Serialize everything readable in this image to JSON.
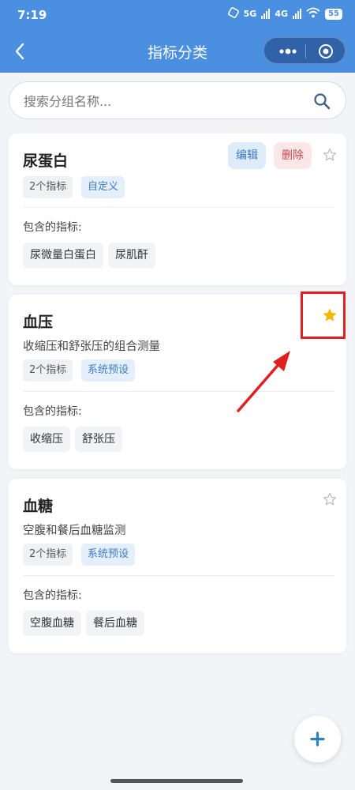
{
  "status": {
    "time": "7:19",
    "net1": "5G",
    "net2": "4G",
    "battery": "55"
  },
  "nav": {
    "title": "指标分类"
  },
  "search": {
    "placeholder": "搜索分组名称..."
  },
  "groups": [
    {
      "title": "尿蛋白",
      "description": "",
      "count": "2个指标",
      "type": "自定义",
      "edit_label": "编辑",
      "delete_label": "删除",
      "favorite": false,
      "includes_label": "包含的指标:",
      "indicators": [
        "尿微量白蛋白",
        "尿肌酐"
      ]
    },
    {
      "title": "血压",
      "description": "收缩压和舒张压的组合测量",
      "count": "2个指标",
      "type": "系统预设",
      "favorite": true,
      "includes_label": "包含的指标:",
      "indicators": [
        "收缩压",
        "舒张压"
      ]
    },
    {
      "title": "血糖",
      "description": "空腹和餐后血糖监测",
      "count": "2个指标",
      "type": "系统预设",
      "favorite": false,
      "includes_label": "包含的指标:",
      "indicators": [
        "空腹血糖",
        "餐后血糖"
      ]
    }
  ],
  "colors": {
    "header": "#4a8fe0",
    "star_active": "#f5b800",
    "star_inactive": "#b8bcc2",
    "annotation": "#e02020",
    "fab_plus": "#2f7fc0"
  },
  "icons": [
    "back-icon",
    "more-dots-icon",
    "close-app-icon",
    "search-icon",
    "star-icon",
    "add-icon"
  ]
}
